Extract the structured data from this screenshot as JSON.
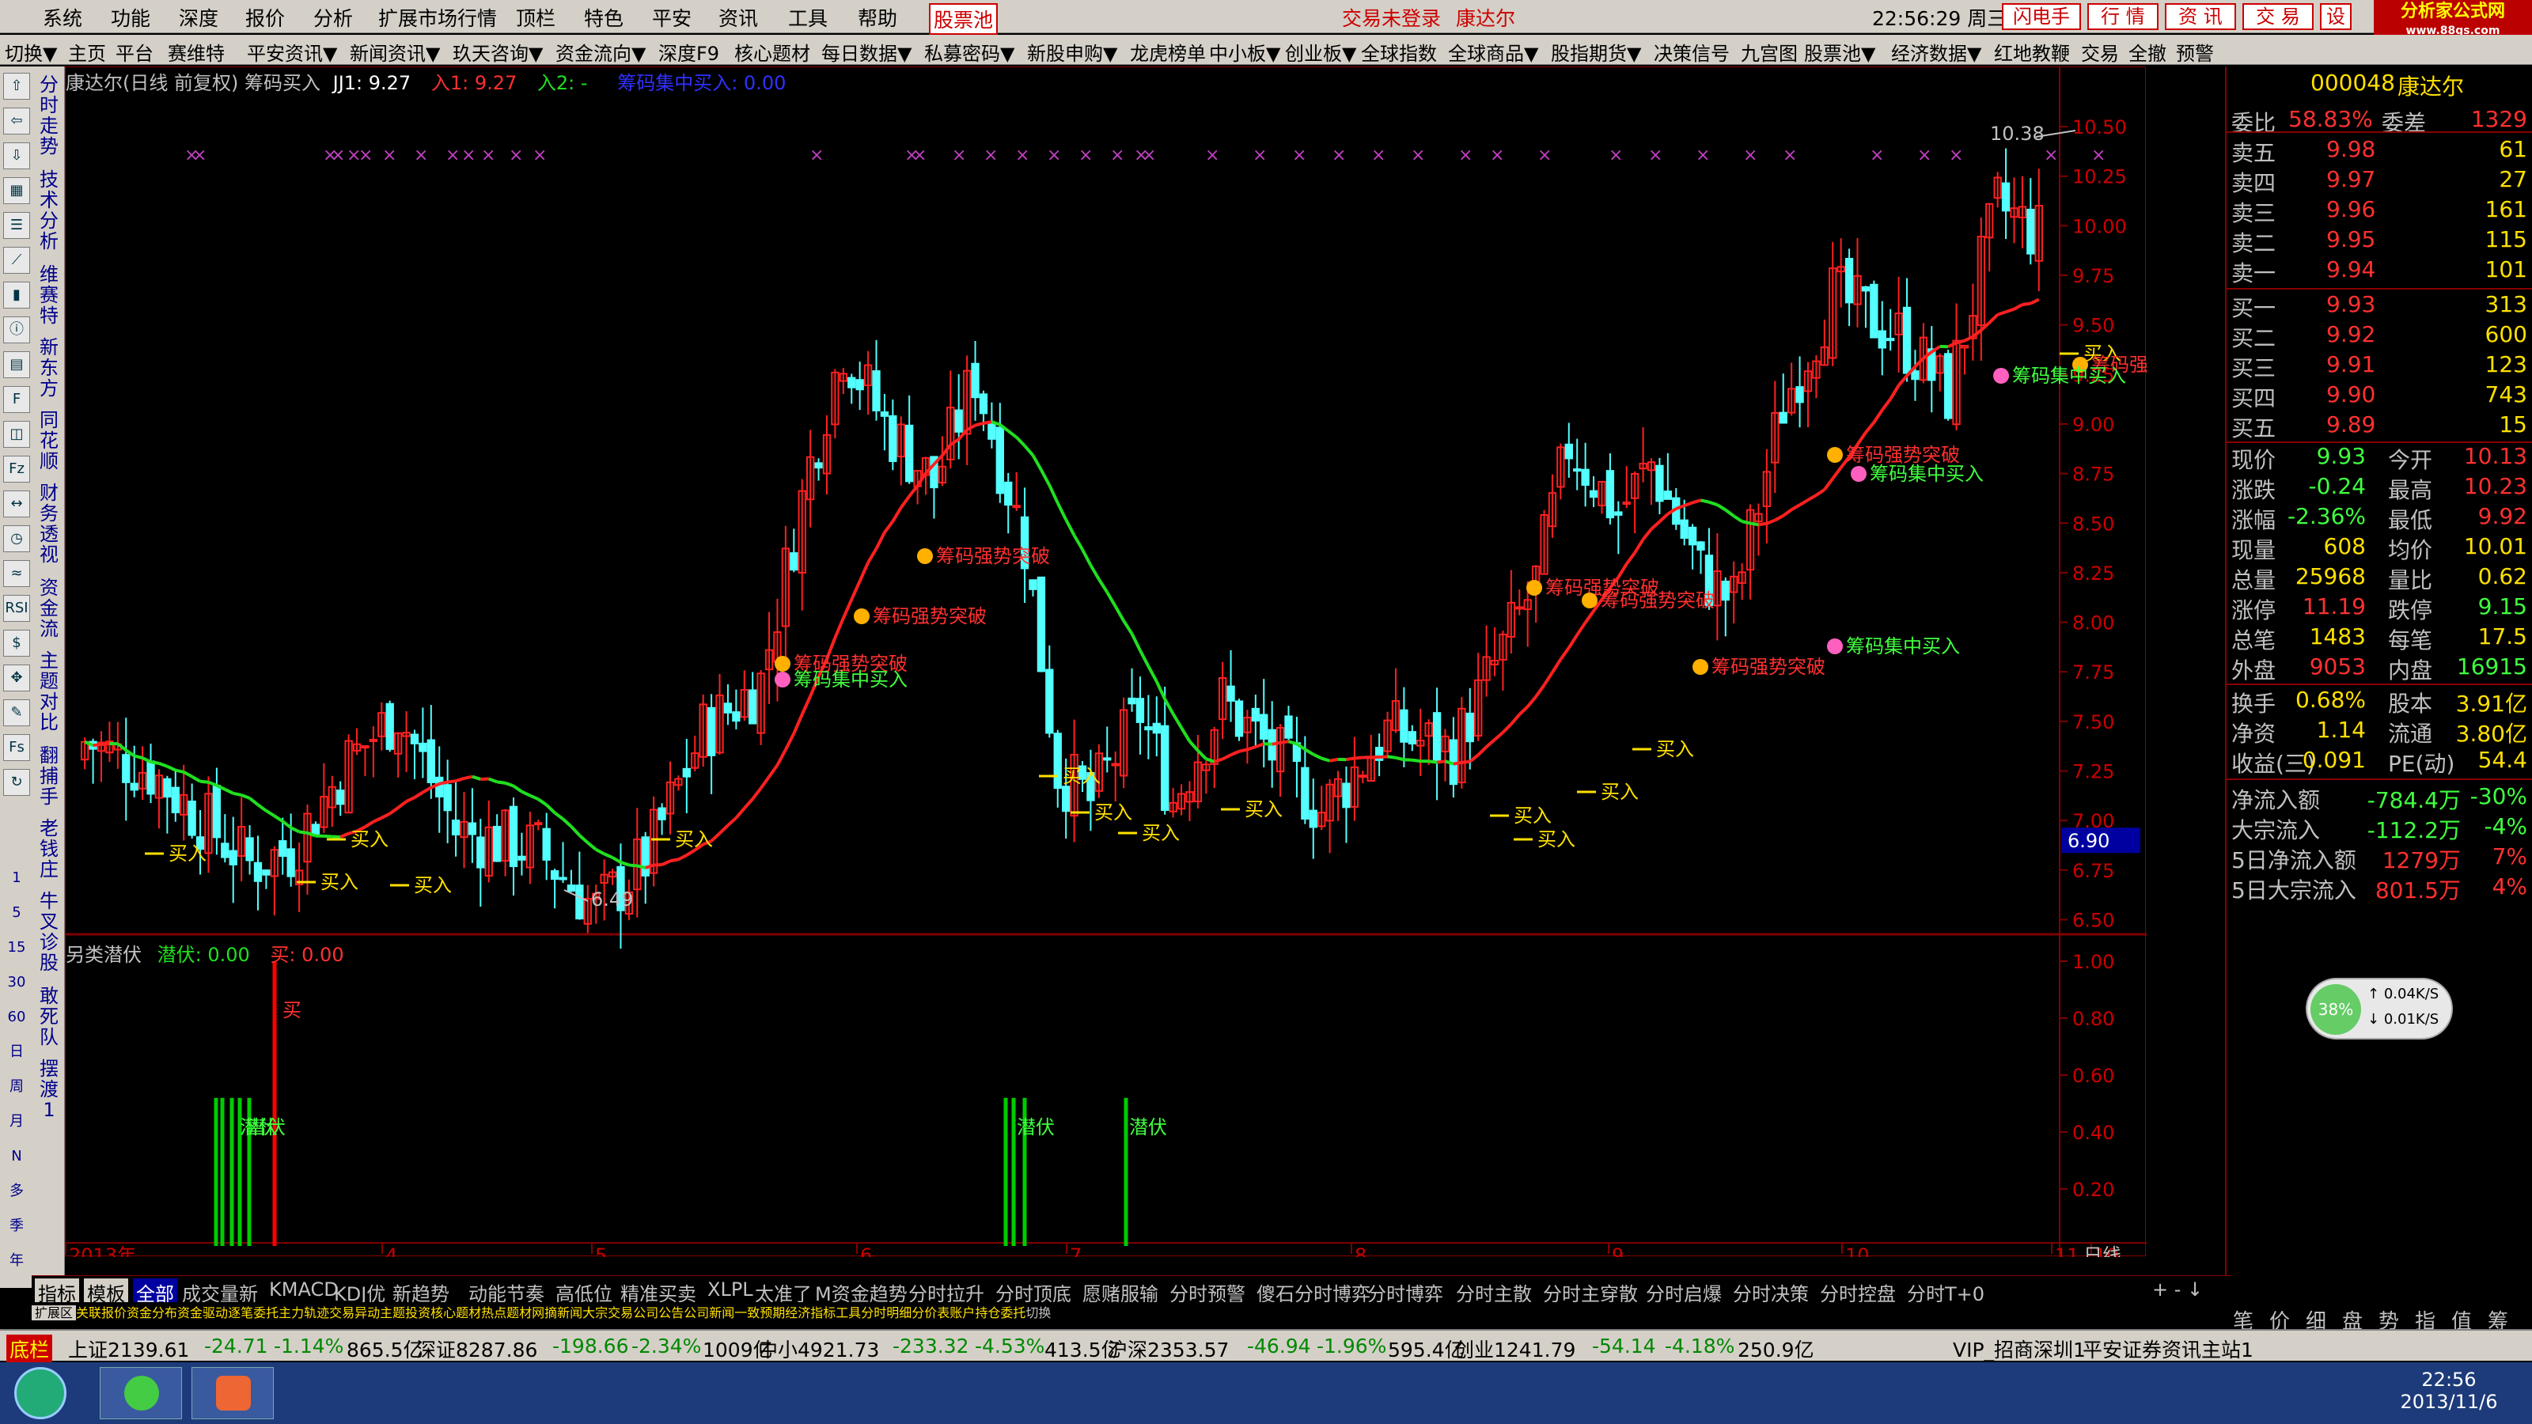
{
  "menu": {
    "items": [
      "系统",
      "功能",
      "深度",
      "报价",
      "分析",
      "扩展市场行情",
      "顶栏",
      "特色",
      "平安",
      "资讯",
      "工具",
      "帮助"
    ],
    "stock_pool": "股票池",
    "login_status": "交易未登录",
    "stock_name": "康达尔",
    "datetime": "22:56:29 周三",
    "right_buttons": [
      "闪电手",
      "行  情",
      "资  讯",
      "交  易",
      "设"
    ],
    "logo_text": "分析家公式网",
    "logo_url": "www.88gs.com"
  },
  "toolbar": {
    "items": [
      "切换▼",
      "主页",
      "平台",
      "赛维特",
      "平安资讯▼",
      "新闻资讯▼",
      "玖天咨询▼",
      "资金流向▼",
      "深度F9",
      "核心题材",
      "每日数据▼",
      "私募密码▼",
      "新股申购▼",
      "龙虎榜单",
      "中小板▼",
      "创业板▼",
      "全球指数",
      "全球商品▼",
      "股指期货▼",
      "决策信号",
      "九宫图",
      "股票池▼",
      "经济数据▼",
      "红地教鞭",
      "交易",
      "全撤",
      "预警"
    ]
  },
  "left_vertical": {
    "labels": [
      "分时走势",
      "技术分析",
      "维赛特",
      "新东方",
      "同花顺",
      "财务透视",
      "资金流",
      "主题对比",
      "翻捕手",
      "老钱庄",
      "牛叉诊股",
      "敢死队",
      "摆渡1"
    ],
    "periods": [
      "1",
      "5",
      "15",
      "30",
      "60",
      "日",
      "周",
      "月",
      "N",
      "多",
      "季",
      "年"
    ]
  },
  "chart": {
    "title": "康达尔(日线 前复权) 筹码买入",
    "jj_label": "JJ1: 9.27",
    "in1_label": "入1: 9.27",
    "in2_label": "入2: -",
    "signal_label": "筹码集中买入: 0.00",
    "high_label": "10.38",
    "low_label": "6.49",
    "current_price_tag": "6.90",
    "y_axis": [
      "10.50",
      "10.25",
      "10.00",
      "9.75",
      "9.50",
      "9.25",
      "9.00",
      "8.75",
      "8.50",
      "8.25",
      "8.00",
      "7.75",
      "7.50",
      "7.25",
      "7.00",
      "6.75",
      "6.50"
    ],
    "lower_title": "另类潜伏",
    "lower_val1": "潜伏: 0.00",
    "lower_val2": "买: 0.00",
    "lower_y": [
      "1.00",
      "0.80",
      "0.60",
      "0.40",
      "0.20"
    ],
    "buy_word": "买",
    "hide_word": "潜伏",
    "x_axis": [
      "2013年",
      "4",
      "5",
      "6",
      "7",
      "8",
      "9",
      "10",
      "11",
      "10"
    ],
    "x_axis_right": "日线",
    "annot_buy": "买入",
    "annot_break": "筹码强势突破",
    "annot_conc": "筹码集中买入",
    "colors": {
      "up": "#ff2020",
      "down": "#54ffff",
      "ma_up": "#ff2020",
      "ma_down": "#20e020",
      "grid": "#800000",
      "buy_line": "#ff0000",
      "hide_line": "#00cc00"
    }
  },
  "quote": {
    "code": "000048",
    "name": "康达尔",
    "weibi_label": "委比",
    "weibi_val": "58.83%",
    "weicha_label": "委差",
    "weicha_val": "1329",
    "sell": [
      {
        "label": "卖五",
        "price": "9.98",
        "vol": "61"
      },
      {
        "label": "卖四",
        "price": "9.97",
        "vol": "27"
      },
      {
        "label": "卖三",
        "price": "9.96",
        "vol": "161"
      },
      {
        "label": "卖二",
        "price": "9.95",
        "vol": "115"
      },
      {
        "label": "卖一",
        "price": "9.94",
        "vol": "101"
      }
    ],
    "buy": [
      {
        "label": "买一",
        "price": "9.93",
        "vol": "313"
      },
      {
        "label": "买二",
        "price": "9.92",
        "vol": "600"
      },
      {
        "label": "买三",
        "price": "9.91",
        "vol": "123"
      },
      {
        "label": "买四",
        "price": "9.90",
        "vol": "743"
      },
      {
        "label": "买五",
        "price": "9.89",
        "vol": "15"
      }
    ],
    "stats": [
      {
        "a": "现价",
        "av": "9.93",
        "b": "今开",
        "bv": "10.13"
      },
      {
        "a": "涨跌",
        "av": "-0.24",
        "b": "最高",
        "bv": "10.23"
      },
      {
        "a": "涨幅",
        "av": "-2.36%",
        "b": "最低",
        "bv": "9.92"
      },
      {
        "a": "现量",
        "av": "608",
        "b": "均价",
        "bv": "10.01"
      },
      {
        "a": "总量",
        "av": "25968",
        "b": "量比",
        "bv": "0.62"
      },
      {
        "a": "涨停",
        "av": "11.19",
        "b": "跌停",
        "bv": "9.15"
      },
      {
        "a": "总笔",
        "av": "1483",
        "b": "每笔",
        "bv": "17.5"
      },
      {
        "a": "外盘",
        "av": "9053",
        "b": "内盘",
        "bv": "16915"
      }
    ],
    "fund": [
      {
        "a": "换手",
        "av": "0.68%",
        "b": "股本",
        "bv": "3.91亿"
      },
      {
        "a": "净资",
        "av": "1.14",
        "b": "流通",
        "bv": "3.80亿"
      },
      {
        "a": "收益(三)",
        "av": "0.091",
        "b": "PE(动)",
        "bv": "54.4"
      }
    ],
    "flow": [
      {
        "a": "净流入额",
        "av": "-784.4万",
        "bv": "-30%"
      },
      {
        "a": "大宗流入",
        "av": "-112.2万",
        "bv": "-4%"
      },
      {
        "a": "5日净流入额",
        "av": "1279万",
        "bv": "7%"
      },
      {
        "a": "5日大宗流入",
        "av": "801.5万",
        "bv": "4%"
      }
    ],
    "net_speed": {
      "pct": "38%",
      "up": "0.04K/S",
      "down": "0.01K/S"
    },
    "bottom_tabs": [
      "笔",
      "价",
      "细",
      "盘",
      "势",
      "指",
      "值",
      "筹"
    ]
  },
  "bottom_tabs": {
    "row1": [
      "指标",
      "模板",
      "全部",
      "成交量新",
      "KMACD",
      "KDJ优",
      "新趋势",
      "动能节奏",
      "高低位",
      "精准买卖",
      "XLPL",
      "太准了",
      "M资金趋势",
      "分时拉升",
      "分时顶底",
      "愿赌服输",
      "分时预警",
      "傻石分时博弈",
      "分时博弈",
      "分时主散",
      "分时主穿散",
      "分时启爆",
      "分时决策",
      "分时控盘",
      "分时T+0"
    ],
    "row2": [
      "扩展区",
      "关联报价",
      "资金分布",
      "资金驱动",
      "逐笔委托",
      "主力轨迹",
      "交易异动",
      "主题投资",
      "核心题材",
      "热点题材",
      "网摘新闻",
      "大宗交易",
      "公司公告",
      "公司新闻",
      "一致预期",
      "经济指标",
      "工具",
      "分时明细",
      "分价表",
      "账户",
      "持仓",
      "委托"
    ],
    "switch_label": "切换"
  },
  "statusbar": {
    "label": "底栏",
    "sh": "上证2139.61",
    "sh_chg": "-24.71",
    "sh_pct": "-1.14%",
    "sh_amt": "865.5亿",
    "sz": "深证8287.86",
    "sz_chg": "-198.66",
    "sz_pct": "-2.34%",
    "sz_amt": "1009亿",
    "zx": "中小4921.73",
    "zx_chg": "-233.32",
    "zx_pct": "-4.53%",
    "zx_amt": "413.5亿",
    "hs": "沪深2353.57",
    "hs_chg": "-46.94",
    "hs_pct": "-1.96%",
    "hs_amt": "595.4亿",
    "cy": "创业1241.79",
    "cy_chg": "-54.14",
    "cy_pct": "-4.18%",
    "cy_amt": "250.9亿",
    "server": "VIP_招商深圳1",
    "broker": "平安证券资讯主站1"
  },
  "taskbar": {
    "time": "22:56",
    "date": "2013/11/6"
  }
}
